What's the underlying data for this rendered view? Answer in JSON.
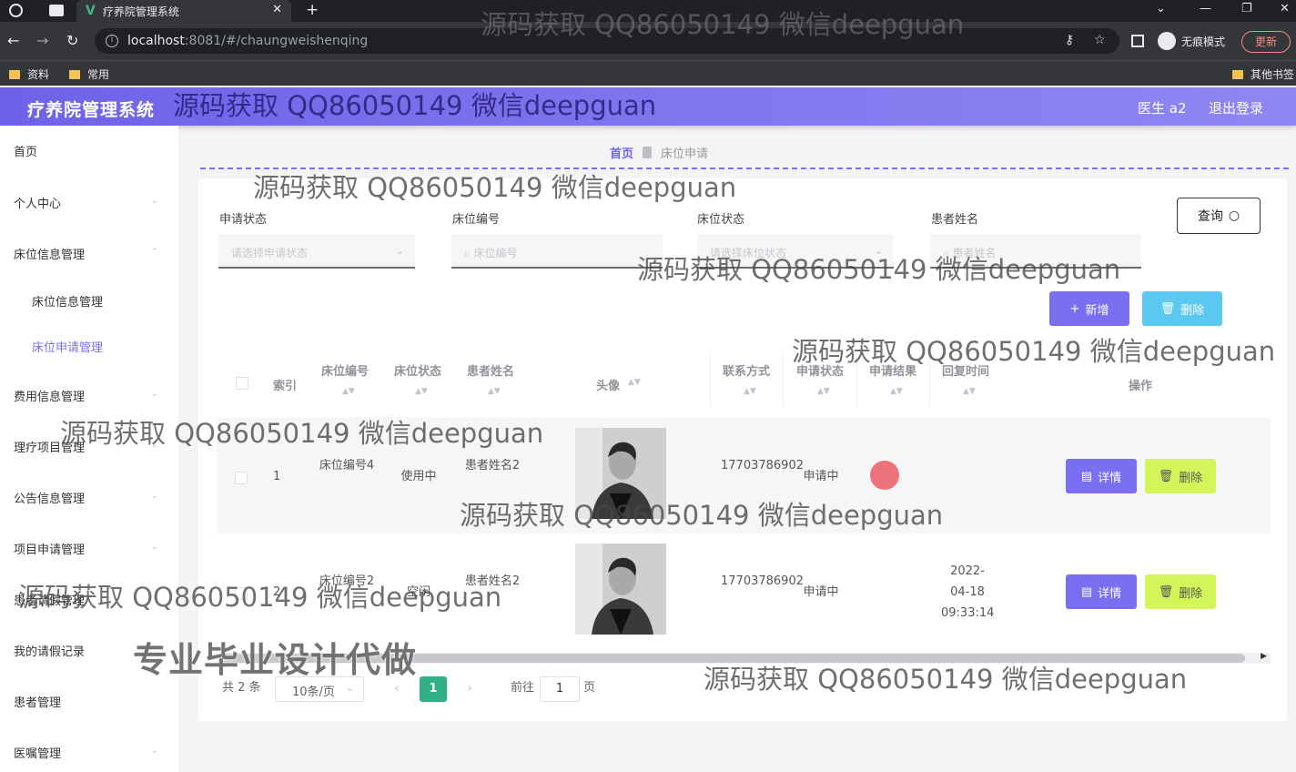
{
  "browser": {
    "tab_title": "疗养院管理系统",
    "url_host": "localhost",
    "url_path": ":8081/#/chaungweishenqing",
    "incognito_label": "无痕模式",
    "update_label": "更新",
    "bookmarks": [
      "资料",
      "常用"
    ],
    "other_bookmarks": "其他书签"
  },
  "header": {
    "title": "疗养院管理系统",
    "user": "医生 a2",
    "logout": "退出登录"
  },
  "sidebar": {
    "items": [
      {
        "label": "首页"
      },
      {
        "label": "个人中心"
      },
      {
        "label": "床位信息管理"
      },
      {
        "label": "床位信息管理"
      },
      {
        "label": "床位申请管理"
      },
      {
        "label": "费用信息管理"
      },
      {
        "label": "理疗项目管理"
      },
      {
        "label": "公告信息管理"
      },
      {
        "label": "项目申请管理"
      },
      {
        "label": "患者请假管理"
      },
      {
        "label": "我的请假记录"
      },
      {
        "label": "患者管理"
      },
      {
        "label": "医嘱管理"
      }
    ]
  },
  "breadcrumb": {
    "home": "首页",
    "current": "床位申请"
  },
  "filters": {
    "status_label": "申请状态",
    "status_placeholder": "请选择申请状态",
    "bed_no_label": "床位编号",
    "bed_no_placeholder": "床位编号",
    "bed_status_label": "床位状态",
    "bed_status_placeholder": "请选择床位状态",
    "patient_label": "患者姓名",
    "patient_placeholder": "患者姓名",
    "query_button": "查询"
  },
  "actions": {
    "add": "新增",
    "delete": "删除"
  },
  "table": {
    "columns": [
      "索引",
      "床位编号",
      "床位状态",
      "患者姓名",
      "头像",
      "联系方式",
      "申请状态",
      "申请结果",
      "回复时间",
      "操作"
    ],
    "rows": [
      {
        "index": "1",
        "bed_no": "床位编号4",
        "bed_status": "使用中",
        "patient": "患者姓名2",
        "contact": "17703786902",
        "status": "申请中",
        "result": "",
        "reply_time": ""
      },
      {
        "index": "2",
        "bed_no": "床位编号2",
        "bed_status": "空闲",
        "patient": "患者姓名2",
        "contact": "17703786902",
        "status": "申请中",
        "result": "",
        "reply_time": "2022-04-18 09:33:14"
      }
    ],
    "detail_btn": "详情",
    "delete_btn": "删除"
  },
  "pagination": {
    "total": "共 2 条",
    "page_size": "10条/页",
    "current_page": "1",
    "goto_label": "前往",
    "goto_value": "1",
    "page_unit": "页"
  },
  "watermarks": {
    "qq": "源码获取 QQ86050149 微信deepguan",
    "big": "专业毕业设计代做"
  }
}
